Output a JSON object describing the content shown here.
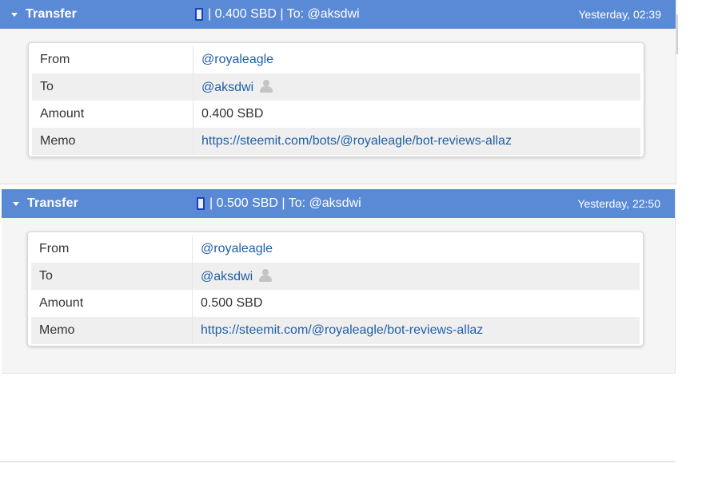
{
  "transfers": [
    {
      "title": "Transfer",
      "summary": "| 0.400 SBD | To: @aksdwi",
      "date": "Yesterday, 02:39",
      "rows": [
        {
          "label": "From",
          "value": "@royaleagle"
        },
        {
          "label": "To",
          "value": "@aksdwi"
        },
        {
          "label": "Amount",
          "value": "0.400 SBD"
        },
        {
          "label": "Memo",
          "value": "https://steemit.com/bots/@royaleagle/bot-reviews-allaz"
        }
      ]
    },
    {
      "title": "Transfer",
      "summary": "| 0.500 SBD | To: @aksdwi",
      "date": "Yesterday, 22:50",
      "rows": [
        {
          "label": "From",
          "value": "@royaleagle"
        },
        {
          "label": "To",
          "value": "@aksdwi"
        },
        {
          "label": "Amount",
          "value": "0.500 SBD"
        },
        {
          "label": "Memo",
          "value": "https://steemit.com/@royaleagle/bot-reviews-allaz"
        }
      ]
    }
  ],
  "icons": {
    "collapse": "caret-down-icon",
    "device": "phone-icon",
    "user": "user-icon"
  },
  "colors": {
    "header": "#5a8ad6",
    "link": "#1f5fa8",
    "device_icon": "#1b3fb8"
  }
}
